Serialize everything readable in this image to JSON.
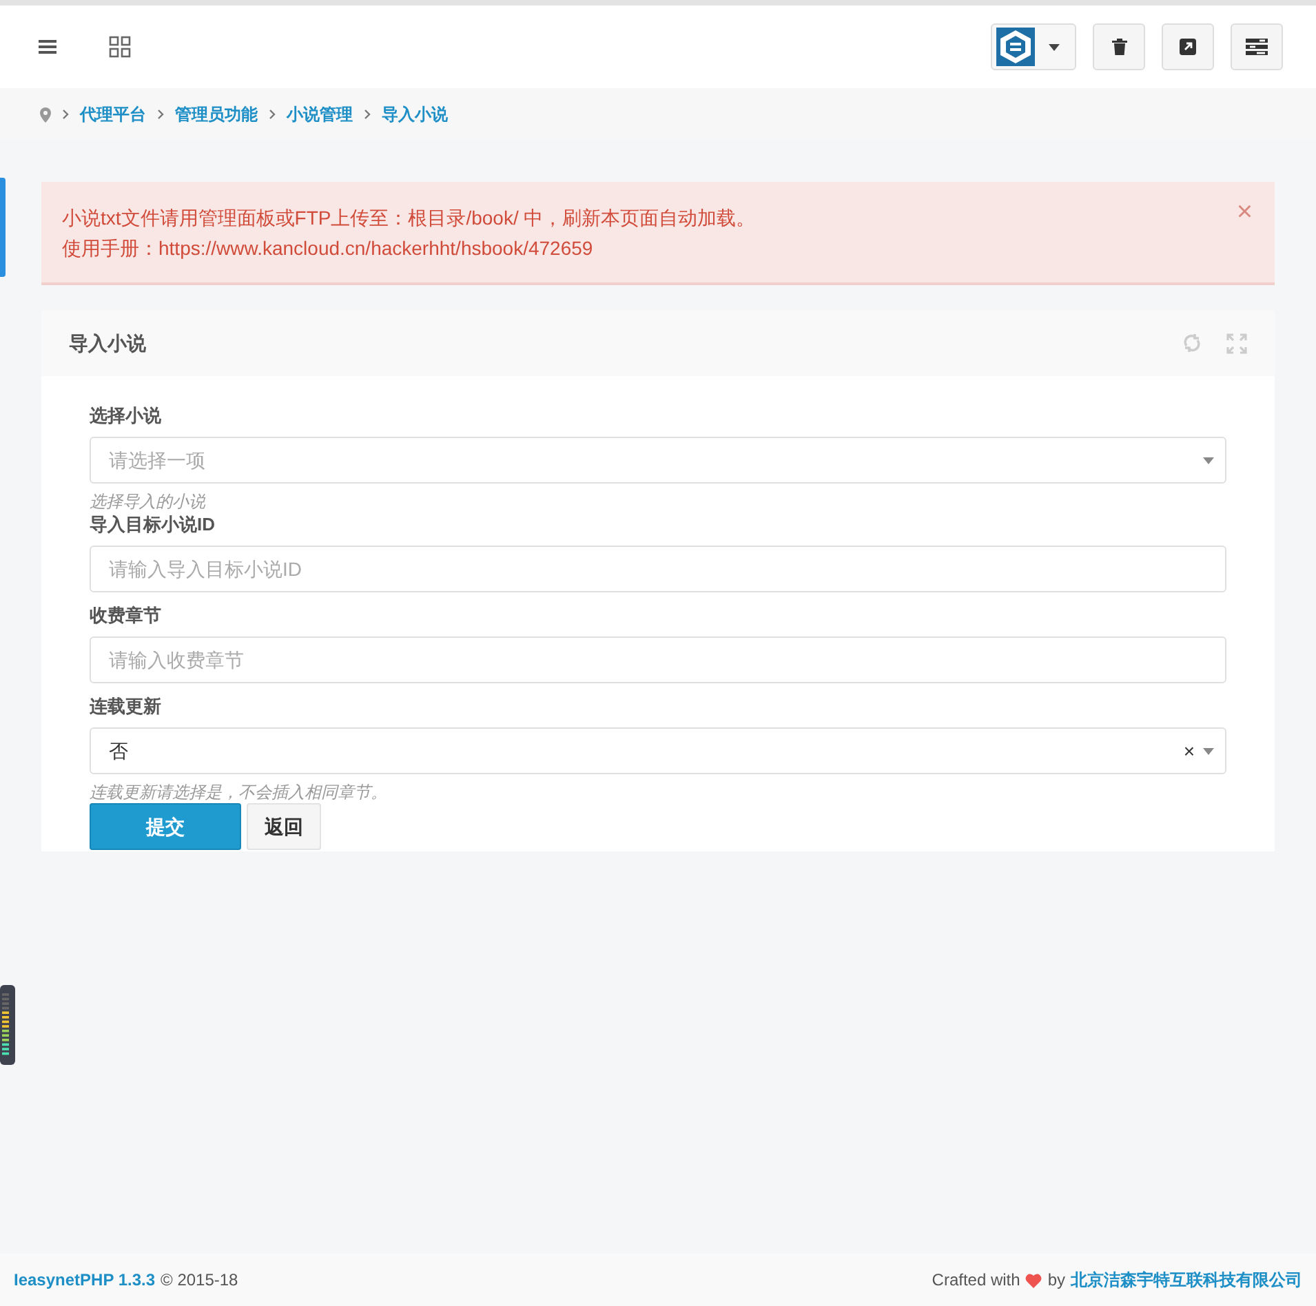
{
  "header": {
    "tools": [
      {
        "kind": "menu"
      },
      {
        "kind": "grid"
      }
    ],
    "actions": [
      {
        "kind": "logo"
      },
      {
        "kind": "trash"
      },
      {
        "kind": "external"
      },
      {
        "kind": "panel"
      }
    ]
  },
  "breadcrumb": [
    "代理平台",
    "管理员功能",
    "小说管理",
    "导入小说"
  ],
  "alert": {
    "lines": [
      "小说txt文件请用管理面板或FTP上传至：根目录/book/ 中，刷新本页面自动加载。",
      "使用手册：https://www.kancloud.cn/hackerhht/hsbook/472659"
    ],
    "close": "×"
  },
  "card": {
    "title": "导入小说",
    "fields": [
      {
        "kind": "select",
        "label": "选择小说",
        "placeholder": "请选择一项",
        "help": "选择导入的小说"
      },
      {
        "kind": "input",
        "label": "导入目标小说ID",
        "placeholder": "请输入导入目标小说ID"
      },
      {
        "kind": "input",
        "label": "收费章节",
        "placeholder": "请输入收费章节"
      },
      {
        "kind": "select",
        "label": "连载更新",
        "value": "否",
        "clear": "×",
        "help": "连载更新请选择是，不会插入相同章节。"
      }
    ],
    "buttons": [
      {
        "label": "提交",
        "primary": true
      },
      {
        "label": "返回",
        "primary": false
      }
    ]
  },
  "footer": {
    "brand": "IeasynetPHP 1.3.3",
    "copyright": "© 2015-18",
    "crafted": "Crafted with",
    "by": "by",
    "company": "北京洁森宇特互联科技有限公司"
  }
}
